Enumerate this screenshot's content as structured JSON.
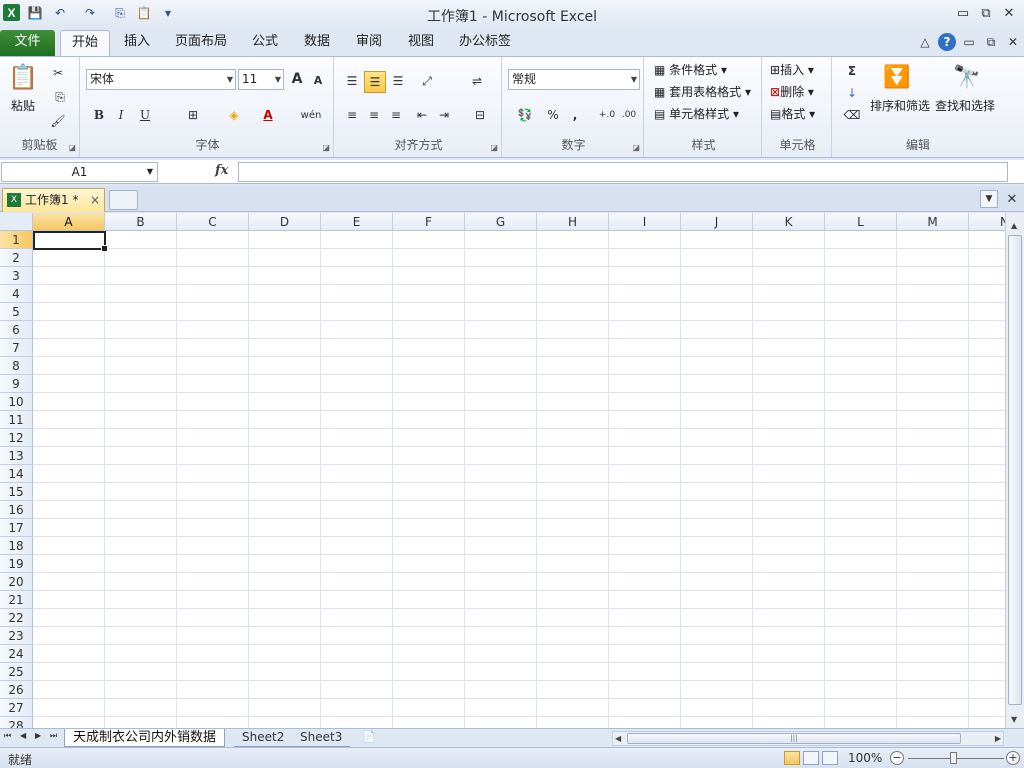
{
  "window": {
    "title": "工作簿1  -  Microsoft Excel",
    "app_icon": "X",
    "controls": {
      "minimize": "▭",
      "restore": "⧉",
      "close": "✕"
    }
  },
  "quick_access": {
    "save": "💾",
    "undo": "↶",
    "redo": "↷",
    "copy": "⎘",
    "paste": "📋",
    "customize": "▾"
  },
  "ribbon_tabs": [
    "文件",
    "开始",
    "插入",
    "页面布局",
    "公式",
    "数据",
    "审阅",
    "视图",
    "办公标签"
  ],
  "ribbon_right": {
    "collapse": "△",
    "help": "?",
    "minimize": "▭",
    "restore": "⧉",
    "close": "✕"
  },
  "clipboard": {
    "paste": "粘贴",
    "label": "剪贴板",
    "cut": "✂",
    "copy": "⎘",
    "format_painter": "🖌"
  },
  "font": {
    "name": "宋体",
    "size": "11",
    "grow": "A",
    "shrink": "A",
    "bold": "B",
    "italic": "I",
    "underline": "U",
    "border": "⊞",
    "fill": "◈",
    "color": "A",
    "phonetic": "wén",
    "label": "字体"
  },
  "alignment": {
    "label": "对齐方式"
  },
  "number": {
    "format": "常规",
    "label": "数字",
    "currency": "💱",
    "percent": "%",
    "comma": ",",
    "inc_decimal": "+.0",
    "dec_decimal": ".00"
  },
  "styles": {
    "conditional": "条件格式",
    "table": "套用表格格式",
    "cell": "单元格样式",
    "label": "样式"
  },
  "cells_group": {
    "insert": "插入",
    "delete": "删除",
    "format": "格式",
    "label": "单元格"
  },
  "editing": {
    "sum": "Σ",
    "sort": "排序和筛选",
    "find": "查找和选择",
    "label": "编辑",
    "fill": "↓",
    "clear": "⌫"
  },
  "formula_bar": {
    "name_box": "A1",
    "fx": "fx",
    "formula": ""
  },
  "workbook_tab": {
    "name": "工作簿1 *",
    "close": "×"
  },
  "columns": [
    "A",
    "B",
    "C",
    "D",
    "E",
    "F",
    "G",
    "H",
    "I",
    "J",
    "K",
    "L",
    "M",
    "N"
  ],
  "rows": [
    "1",
    "2",
    "3",
    "4",
    "5",
    "6",
    "7",
    "8",
    "9",
    "10",
    "11",
    "12",
    "13",
    "14",
    "15",
    "16",
    "17",
    "18",
    "19",
    "20",
    "21",
    "22",
    "23",
    "24",
    "25",
    "26",
    "27",
    "28"
  ],
  "sheets": [
    "天成制衣公司内外销数据",
    "Sheet2",
    "Sheet3"
  ],
  "status": {
    "text": "就绪",
    "zoom": "100%"
  },
  "colors": {
    "file_tab": "#1f6f21",
    "selected": "#f5c760",
    "accent": "#2f6fc4"
  }
}
